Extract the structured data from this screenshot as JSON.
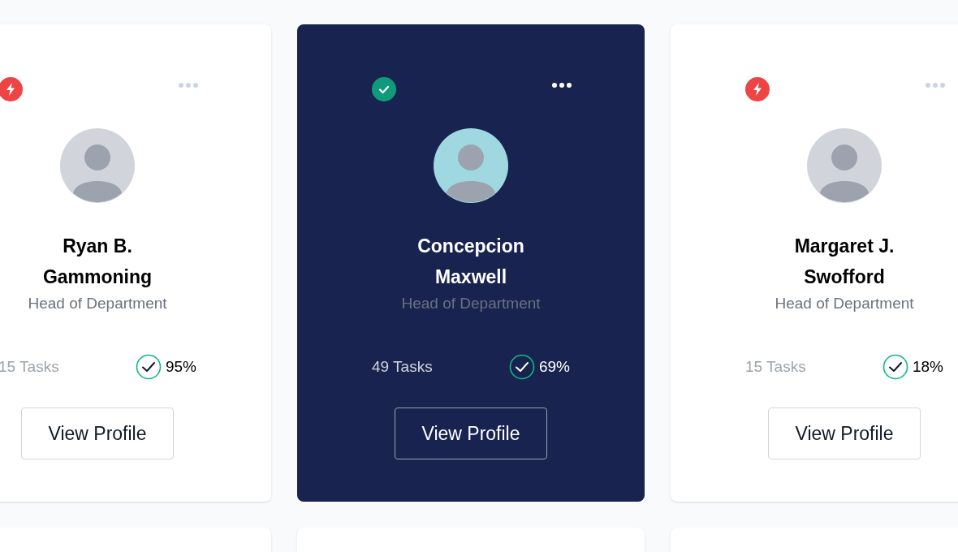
{
  "cards": [
    {
      "kind": "bolt",
      "selected": false,
      "name": "Ryan B. Gammoning",
      "role": "Head of Department",
      "tasks": "15 Tasks",
      "progress": "95%",
      "button": "View Profile"
    },
    {
      "kind": "check",
      "selected": true,
      "name": "Concepcion Maxwell",
      "role": "Head of Department",
      "tasks": "49 Tasks",
      "progress": "69%",
      "button": "View Profile"
    },
    {
      "kind": "bolt",
      "selected": false,
      "name": "Margaret J. Swofford",
      "role": "Head of Department",
      "tasks": "15 Tasks",
      "progress": "18%",
      "button": "View Profile"
    }
  ]
}
